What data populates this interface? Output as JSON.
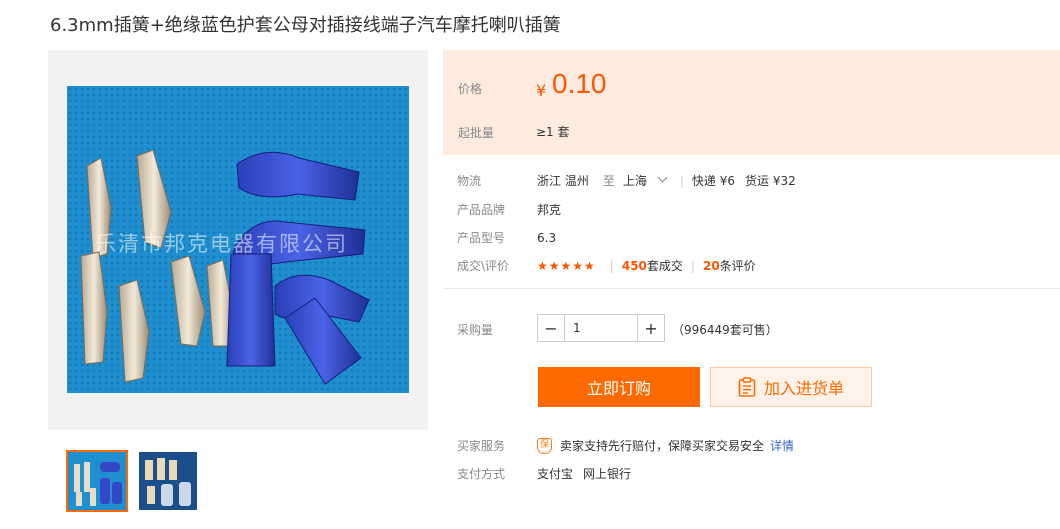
{
  "product": {
    "title": "6.3mm插簧+绝缘蓝色护套公母对插接线端子汽车摩托喇叭插簧"
  },
  "gallery": {
    "watermark": "乐清市邦克电器有限公司",
    "thumbnails": [
      "thumb-1",
      "thumb-2"
    ],
    "active_index": 0
  },
  "price": {
    "label": "价格",
    "currency": "¥",
    "value": "0.10",
    "moq_label": "起批量",
    "moq_value": "≥1 套"
  },
  "logistics": {
    "label": "物流",
    "from": "浙江 温州",
    "to_word": "至",
    "to": "上海",
    "express": "快递 ¥6",
    "freight": "货运 ¥32"
  },
  "brand": {
    "label": "产品品牌",
    "value": "邦克"
  },
  "model": {
    "label": "产品型号",
    "value": "6.3"
  },
  "deals": {
    "label": "成交\\评价",
    "stars": "★★★★★",
    "sold_count": "450",
    "sold_suffix": "套成交",
    "review_count": "20",
    "review_suffix": "条评价"
  },
  "purchase": {
    "label": "采购量",
    "quantity": "1",
    "minus": "−",
    "plus": "+",
    "stock": "（996449套可售）"
  },
  "actions": {
    "buy_now": "立即订购",
    "add_to_cart": "加入进货单"
  },
  "service": {
    "label": "买家服务",
    "badge": "保",
    "text": "卖家支持先行赔付，保障买家交易安全",
    "link": "详情"
  },
  "payment": {
    "label": "支付方式",
    "methods": [
      "支付宝",
      "网上银行"
    ]
  },
  "colors": {
    "accent": "#ff6a00",
    "price": "#ff5500",
    "price_bg": "#fdebdf",
    "link": "#3366cc"
  }
}
